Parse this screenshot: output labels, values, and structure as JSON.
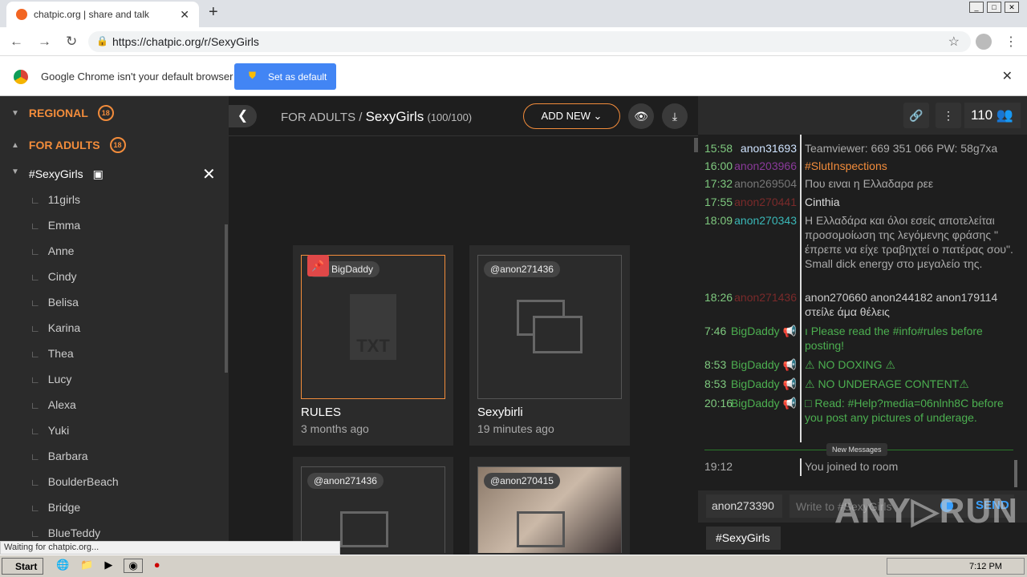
{
  "browser": {
    "tab_title": "chatpic.org | share and talk",
    "url": "https://chatpic.org/r/SexyGirls",
    "infobar_message": "Google Chrome isn't your default browser",
    "set_default": "Set as default",
    "status": "Waiting for chatpic.org..."
  },
  "sidebar": {
    "categories": [
      {
        "label": "REGIONAL",
        "badge": "18"
      },
      {
        "label": "FOR ADULTS",
        "badge": "18"
      }
    ],
    "room": "#SexyGirls",
    "subrooms": [
      "11girls",
      "Emma",
      "Anne",
      "Cindy",
      "Belisa",
      "Karina",
      "Thea",
      "Lucy",
      "Alexa",
      "Yuki",
      "Barbara",
      "BoulderBeach",
      "Bridge",
      "BlueTeddy"
    ]
  },
  "main": {
    "crumb_parent": "FOR ADULTS /",
    "crumb_room": "SexyGirls",
    "crumb_count": "(100/100)",
    "add_new": "ADD NEW",
    "cards": [
      {
        "tag": "BigDaddy",
        "title": "RULES",
        "date": "3 months ago",
        "icon": "txt-file-icon"
      },
      {
        "tag": "@anon271436",
        "title": "Sexybirli",
        "date": "19 minutes ago",
        "icon": "gallery-icon"
      },
      {
        "tag": "@anon271436",
        "title": "",
        "date": "",
        "icon": "gallery-icon"
      },
      {
        "tag": "@anon270415",
        "title": "",
        "date": "",
        "icon": "gallery-icon"
      }
    ]
  },
  "chat": {
    "users_count": "110",
    "messages": [
      {
        "time": "15:58",
        "user": "anon31693",
        "user_color": "#cfe3ff",
        "text": "Teamviewer: 669 351 066 PW: 58g7xa",
        "color": "#aaaaaa"
      },
      {
        "time": "16:00",
        "user": "anon203966",
        "user_color": "#8a3a9a",
        "text": "#SlutInspections",
        "color": "#f28c3b"
      },
      {
        "time": "17:32",
        "user": "anon269504",
        "user_color": "#777777",
        "text": "Που ειναι η Ελλαδαρα ρεε",
        "color": "#aaaaaa"
      },
      {
        "time": "17:55",
        "user": "anon270441",
        "user_color": "#7a2a2a",
        "text": "Cinthia",
        "color": "#dddddd"
      },
      {
        "time": "18:09",
        "user": "anon270343",
        "user_color": "#3ab8b8",
        "text": "Η Ελλαδάρα και όλοι εσείς αποτελείται προσομοίωση της λεγόμενης φράσης \" έπρεπε να είχε τραβηχτεί ο πατέρας σου\". Small dick energy στο μεγαλείο της.",
        "color": "#aaaaaa"
      },
      {
        "time": "18:26",
        "user": "anon271436",
        "user_color": "#7a2a2a",
        "text": "anon270660 anon244182 anon179114 στείλε άμα θέλεις",
        "color": "#cccccc"
      },
      {
        "time": "7:46",
        "user": "BigDaddy",
        "user_color": "#4caf50",
        "text": "ı Please read the #info#rules before posting!",
        "color": "#4caf50"
      },
      {
        "time": "8:53",
        "user": "BigDaddy",
        "user_color": "#4caf50",
        "text": "⚠ NO DOXING ⚠",
        "color": "#4caf50"
      },
      {
        "time": "8:53",
        "user": "BigDaddy",
        "user_color": "#4caf50",
        "text": "⚠ NO UNDERAGE CONTENT⚠",
        "color": "#4caf50"
      },
      {
        "time": "20:16",
        "user": "BigDaddy",
        "user_color": "#4caf50",
        "text": "□ Read: #Help?media=06nlnh8C before you post any pictures of underage.",
        "color": "#4caf50"
      }
    ],
    "new_messages": "New Messages",
    "join_time": "19:12",
    "join_text": "You joined to room",
    "nick": "anon273390",
    "placeholder": "Write to #SexyGirls",
    "send": "SEND",
    "channel_tag": "#SexyGirls"
  },
  "taskbar": {
    "start": "Start",
    "clock": "7:12 PM"
  },
  "watermark": "ANY RUN"
}
